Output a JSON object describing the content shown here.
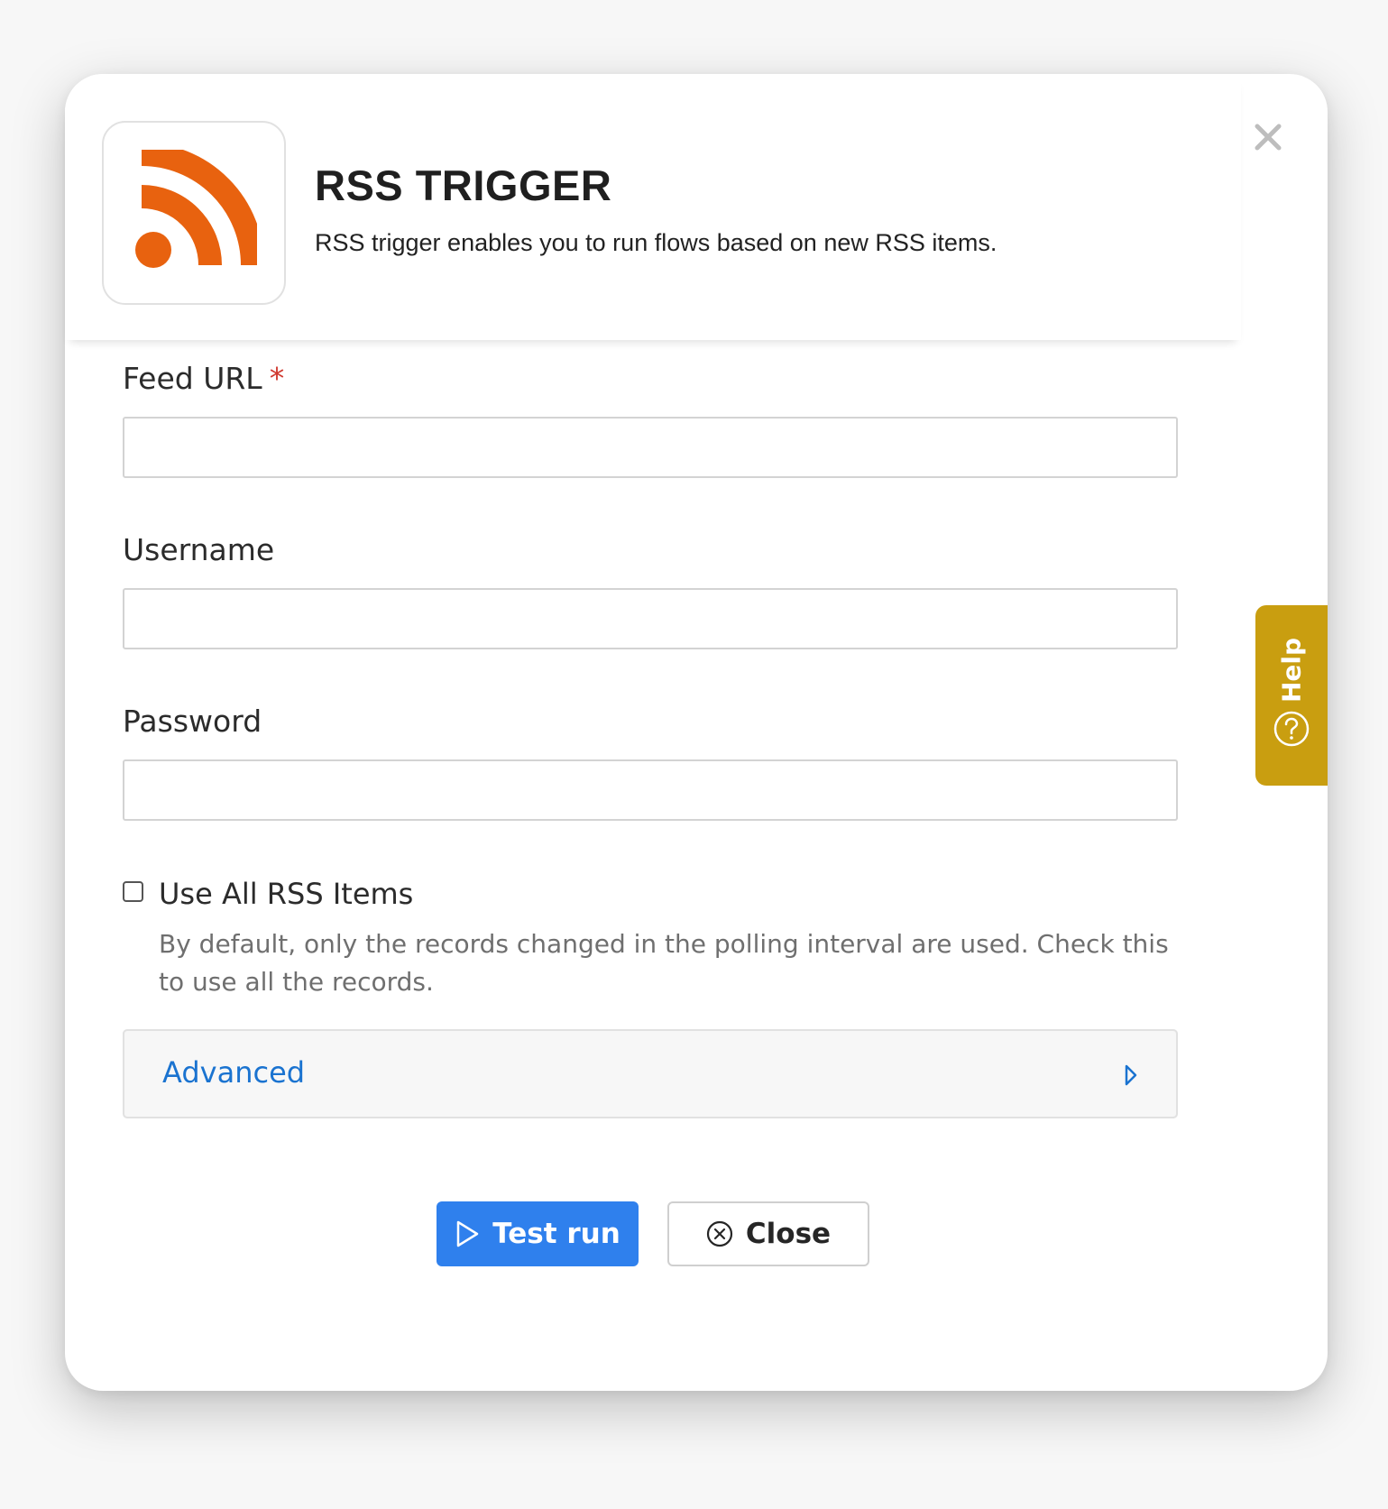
{
  "header": {
    "title": "RSS TRIGGER",
    "subtitle": "RSS trigger enables you to run flows based on new RSS items.",
    "logo_icon": "rss-icon",
    "close_icon": "close-icon"
  },
  "form": {
    "feed_url": {
      "label": "Feed URL",
      "required_marker": "*",
      "value": "",
      "placeholder": ""
    },
    "username": {
      "label": "Username",
      "value": "",
      "placeholder": ""
    },
    "password": {
      "label": "Password",
      "value": "",
      "placeholder": ""
    },
    "use_all": {
      "label": "Use All RSS Items",
      "checked": false,
      "help": "By default, only the records changed in the polling interval are used. Check this to use all the records."
    },
    "advanced": {
      "label": "Advanced",
      "icon": "chevron-right-icon"
    }
  },
  "actions": {
    "test_run": {
      "label": "Test run",
      "icon": "play-icon"
    },
    "close": {
      "label": "Close",
      "icon": "circle-x-icon"
    }
  },
  "help_tab": {
    "label": "Help",
    "icon": "question-circle-icon"
  },
  "colors": {
    "rss_orange": "#e8620f",
    "primary_blue": "#2f80ed",
    "link_blue": "#1a73d0",
    "help_gold": "#c99e10",
    "required_red": "#d0392f"
  }
}
